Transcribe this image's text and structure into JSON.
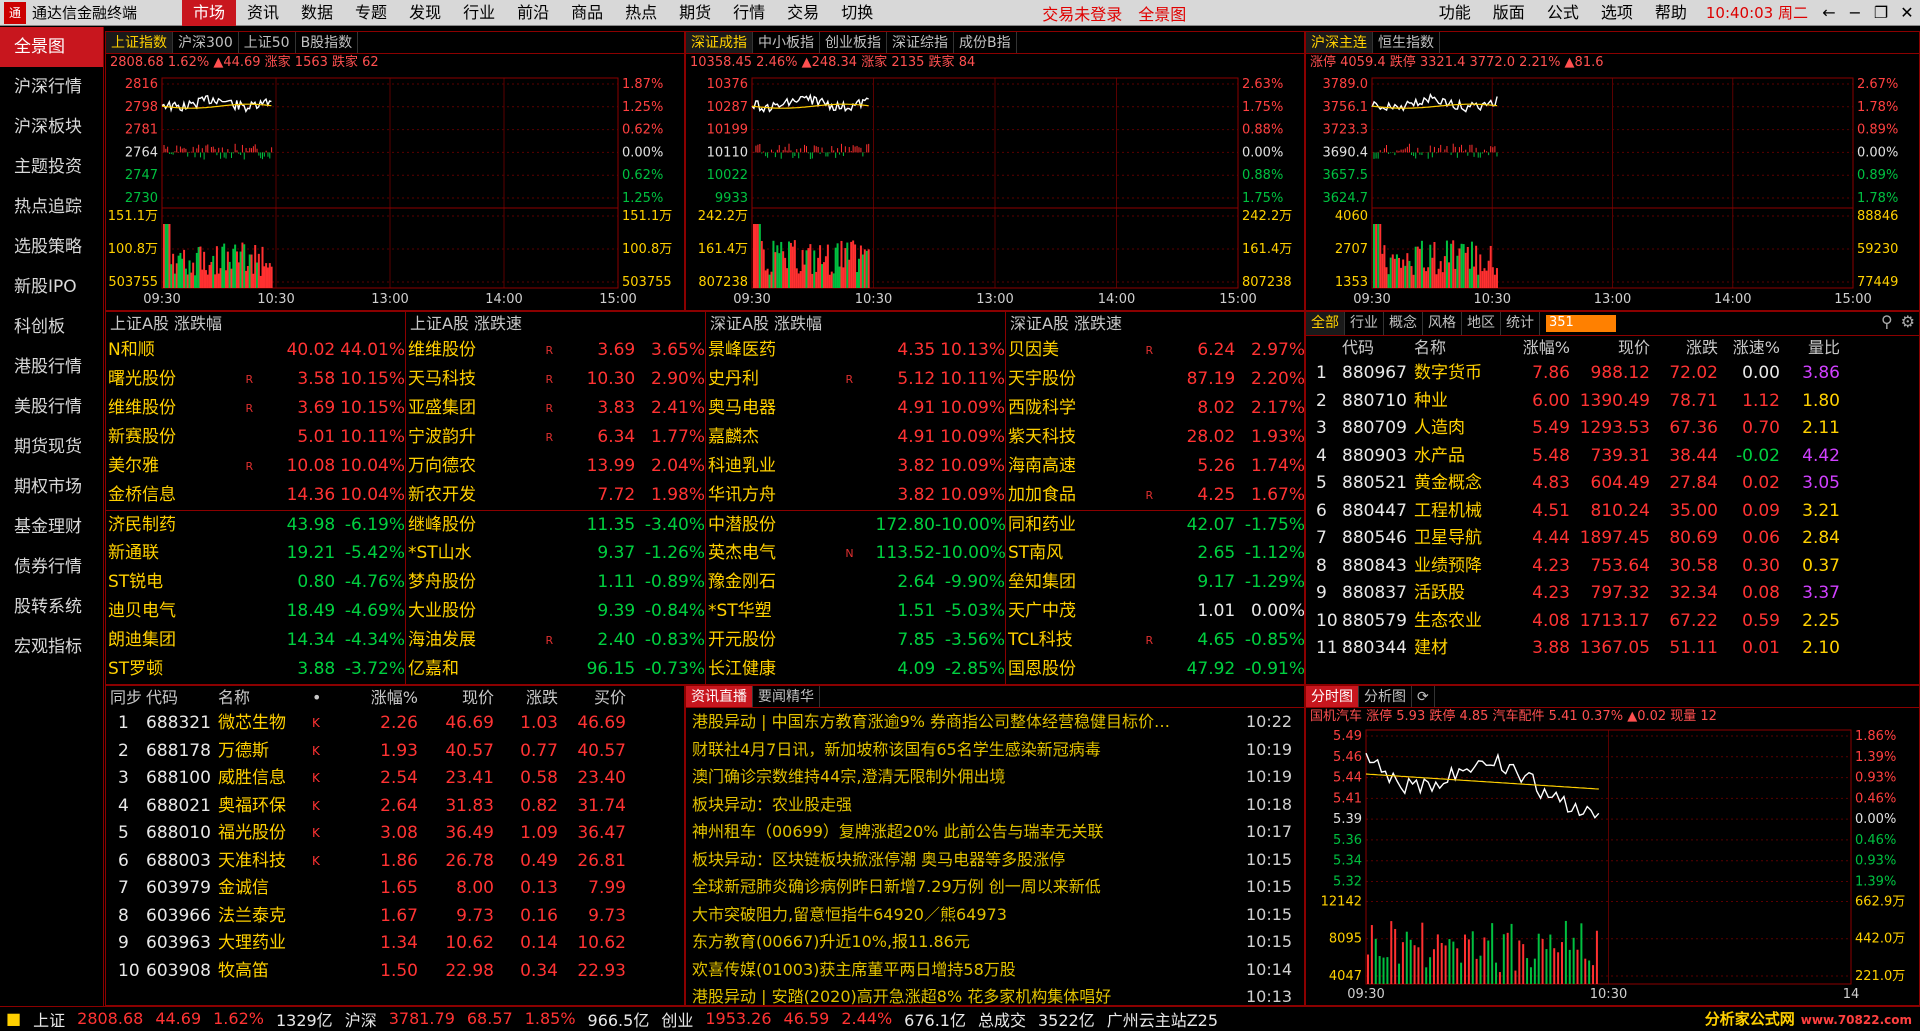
{
  "app": {
    "title": "通达信金融终端"
  },
  "menu": [
    "市场",
    "资讯",
    "数据",
    "专题",
    "发现",
    "行业",
    "前沿",
    "商品",
    "热点",
    "期货",
    "行情",
    "交易",
    "切换"
  ],
  "menu_alerts": [
    "交易未登录",
    "全景图"
  ],
  "right_menu": [
    "功能",
    "版面",
    "公式",
    "选项",
    "帮助"
  ],
  "clock": "10:40:03 周二",
  "sidebar": [
    "全景图",
    "沪深行情",
    "沪深板块",
    "主题投资",
    "热点追踪",
    "选股策略",
    "新股IPO",
    "科创板",
    "港股行情",
    "美股行情",
    "期货现货",
    "期权市场",
    "基金理财",
    "债券行情",
    "股转系统",
    "宏观指标"
  ],
  "charts": [
    {
      "tabs": [
        "上证指数",
        "沪深300",
        "上证50",
        "B股指数"
      ],
      "info": "2808.68 1.62% ▲44.69 涨家 1563 跌家 62",
      "price_labels": [
        "2816",
        "2798",
        "2781",
        "2764",
        "2747",
        "2730"
      ],
      "pct_labels": [
        "1.87%",
        "1.25%",
        "0.62%",
        "0.00%",
        "0.62%",
        "1.25%"
      ],
      "vol_labels": [
        "151.1万",
        "100.8万",
        "503755"
      ],
      "vol_labels_r": [
        "151.1万",
        "100.8万",
        "503755"
      ],
      "times": [
        "09:30",
        "10:30",
        "13:00",
        "14:00",
        "15:00"
      ]
    },
    {
      "tabs": [
        "深证成指",
        "中小板指",
        "创业板指",
        "深证综指",
        "成份B指"
      ],
      "info": "10358.45 2.46% ▲248.34 涨家 2135 跌家 84",
      "price_labels": [
        "10376",
        "10287",
        "10199",
        "10110",
        "10022",
        "9933"
      ],
      "pct_labels": [
        "2.63%",
        "1.75%",
        "0.88%",
        "0.00%",
        "0.88%",
        "1.75%"
      ],
      "vol_labels": [
        "242.2万",
        "161.4万",
        "807238"
      ],
      "vol_labels_r": [
        "242.2万",
        "161.4万",
        "807238"
      ],
      "times": [
        "09:30",
        "10:30",
        "13:00",
        "14:00",
        "15:00"
      ]
    },
    {
      "tabs": [
        "沪深主连",
        "恒生指数"
      ],
      "info": "涨停 4059.4 跌停 3321.4 3772.0 2.21% ▲81.6",
      "price_labels": [
        "3789.0",
        "3756.1",
        "3723.3",
        "3690.4",
        "3657.5",
        "3624.7"
      ],
      "pct_labels": [
        "2.67%",
        "1.78%",
        "0.89%",
        "0.00%",
        "0.89%",
        "1.78%"
      ],
      "vol_labels": [
        "4060",
        "2707",
        "1353"
      ],
      "vol_labels_r": [
        "88846",
        "59230",
        "77449"
      ],
      "times": [
        "09:30",
        "10:30",
        "13:00",
        "14:00",
        "15:00"
      ]
    }
  ],
  "rankings": [
    {
      "title": "上证A股  涨跌幅",
      "rows": [
        [
          "N和顺",
          "",
          "40.02",
          "44.01%"
        ],
        [
          "曙光股份",
          "R",
          "3.58",
          "10.15%"
        ],
        [
          "维维股份",
          "R",
          "3.69",
          "10.15%"
        ],
        [
          "新赛股份",
          "",
          "5.01",
          "10.11%"
        ],
        [
          "美尔雅",
          "R",
          "10.08",
          "10.04%"
        ],
        [
          "金桥信息",
          "",
          "14.36",
          "10.04%"
        ],
        [
          "济民制药",
          "",
          "43.98",
          "-6.19%"
        ],
        [
          "新通联",
          "",
          "19.21",
          "-5.42%"
        ],
        [
          "ST锐电",
          "",
          "0.80",
          "-4.76%"
        ],
        [
          "迪贝电气",
          "",
          "18.49",
          "-4.69%"
        ],
        [
          "朗迪集团",
          "",
          "14.34",
          "-4.34%"
        ],
        [
          "ST罗顿",
          "",
          "3.88",
          "-3.72%"
        ]
      ]
    },
    {
      "title": "上证A股  涨跌速",
      "rows": [
        [
          "维维股份",
          "R",
          "3.69",
          "3.65%"
        ],
        [
          "天马科技",
          "R",
          "10.30",
          "2.90%"
        ],
        [
          "亚盛集团",
          "R",
          "3.83",
          "2.41%"
        ],
        [
          "宁波韵升",
          "R",
          "6.34",
          "1.77%"
        ],
        [
          "万向德农",
          "",
          "13.99",
          "2.04%"
        ],
        [
          "新农开发",
          "",
          "7.72",
          "1.98%"
        ],
        [
          "继峰股份",
          "",
          "11.35",
          "-3.40%"
        ],
        [
          "*ST山水",
          "",
          "9.37",
          "-1.26%"
        ],
        [
          "梦舟股份",
          "",
          "1.11",
          "-0.89%"
        ],
        [
          "大业股份",
          "",
          "9.39",
          "-0.84%"
        ],
        [
          "海油发展",
          "R",
          "2.40",
          "-0.83%"
        ],
        [
          "亿嘉和",
          "",
          "96.15",
          "-0.73%"
        ]
      ]
    },
    {
      "title": "深证A股  涨跌幅",
      "rows": [
        [
          "景峰医药",
          "",
          "4.35",
          "10.13%"
        ],
        [
          "史丹利",
          "R",
          "5.12",
          "10.11%"
        ],
        [
          "奥马电器",
          "",
          "4.91",
          "10.09%"
        ],
        [
          "嘉麟杰",
          "",
          "4.91",
          "10.09%"
        ],
        [
          "科迪乳业",
          "",
          "3.82",
          "10.09%"
        ],
        [
          "华讯方舟",
          "",
          "3.82",
          "10.09%"
        ],
        [
          "中潜股份",
          "",
          "172.80",
          "-10.00%"
        ],
        [
          "英杰电气",
          "N",
          "113.52",
          "-10.00%"
        ],
        [
          "豫金刚石",
          "",
          "2.64",
          "-9.90%"
        ],
        [
          "*ST华塑",
          "",
          "1.51",
          "-5.03%"
        ],
        [
          "开元股份",
          "",
          "7.85",
          "-3.56%"
        ],
        [
          "长江健康",
          "",
          "4.09",
          "-2.85%"
        ]
      ]
    },
    {
      "title": "深证A股  涨跌速",
      "rows": [
        [
          "贝因美",
          "R",
          "6.24",
          "2.97%"
        ],
        [
          "天宇股份",
          "",
          "87.19",
          "2.20%"
        ],
        [
          "西陇科学",
          "",
          "8.02",
          "2.17%"
        ],
        [
          "紫天科技",
          "",
          "28.02",
          "1.93%"
        ],
        [
          "海南高速",
          "",
          "5.26",
          "1.74%"
        ],
        [
          "加加食品",
          "R",
          "4.25",
          "1.67%"
        ],
        [
          "同和药业",
          "",
          "42.07",
          "-1.75%"
        ],
        [
          "ST南风",
          "",
          "2.65",
          "-1.12%"
        ],
        [
          "垒知集团",
          "",
          "9.17",
          "-1.29%"
        ],
        [
          "天广中茂",
          "",
          "1.01",
          "0.00%"
        ],
        [
          "TCL科技",
          "R",
          "4.65",
          "-0.85%"
        ],
        [
          "国恩股份",
          "",
          "47.92",
          "-0.91%"
        ]
      ]
    }
  ],
  "sector": {
    "tabs": [
      "全部",
      "行业",
      "概念",
      "风格",
      "地区",
      "统计"
    ],
    "search": "351",
    "headers": [
      "",
      "代码",
      "名称",
      "涨幅%",
      "现价",
      "涨跌",
      "涨速%",
      "量比"
    ],
    "rows": [
      [
        "1",
        "880967",
        "数字货币",
        "7.86",
        "988.12",
        "72.02",
        "0.00",
        "3.86"
      ],
      [
        "2",
        "880710",
        "种业",
        "6.00",
        "1390.49",
        "78.71",
        "1.12",
        "1.80"
      ],
      [
        "3",
        "880709",
        "人造肉",
        "5.49",
        "1293.53",
        "67.36",
        "0.70",
        "2.11"
      ],
      [
        "4",
        "880903",
        "水产品",
        "5.48",
        "739.31",
        "38.44",
        "-0.02",
        "4.42"
      ],
      [
        "5",
        "880521",
        "黄金概念",
        "4.83",
        "604.49",
        "27.84",
        "0.02",
        "3.05"
      ],
      [
        "6",
        "880447",
        "工程机械",
        "4.51",
        "810.24",
        "35.00",
        "0.09",
        "3.21"
      ],
      [
        "7",
        "880546",
        "卫星导航",
        "4.44",
        "1897.45",
        "80.69",
        "0.06",
        "2.84"
      ],
      [
        "8",
        "880843",
        "业绩预降",
        "4.23",
        "753.64",
        "30.58",
        "0.30",
        "0.37"
      ],
      [
        "9",
        "880837",
        "活跃股",
        "4.23",
        "797.32",
        "32.34",
        "0.08",
        "3.37"
      ],
      [
        "10",
        "880579",
        "生态农业",
        "4.08",
        "1713.17",
        "67.22",
        "0.59",
        "2.25"
      ],
      [
        "11",
        "880344",
        "建材",
        "3.88",
        "1367.05",
        "51.11",
        "0.01",
        "2.10"
      ]
    ]
  },
  "stocks": {
    "headers": [
      "同步",
      "代码",
      "名称",
      "•",
      "涨幅%",
      "现价",
      "涨跌",
      "买价"
    ],
    "rows": [
      [
        "1",
        "688321",
        "微芯生物",
        "K",
        "2.26",
        "46.69",
        "1.03",
        "46.69"
      ],
      [
        "2",
        "688178",
        "万德斯",
        "K",
        "1.93",
        "40.57",
        "0.77",
        "40.57"
      ],
      [
        "3",
        "688100",
        "威胜信息",
        "K",
        "2.54",
        "23.41",
        "0.58",
        "23.40"
      ],
      [
        "4",
        "688021",
        "奥福环保",
        "K",
        "2.64",
        "31.83",
        "0.82",
        "31.74"
      ],
      [
        "5",
        "688010",
        "福光股份",
        "K",
        "3.08",
        "36.49",
        "1.09",
        "36.47"
      ],
      [
        "6",
        "688003",
        "天准科技",
        "K",
        "1.86",
        "26.78",
        "0.49",
        "26.81"
      ],
      [
        "7",
        "603979",
        "金诚信",
        "",
        "1.65",
        "8.00",
        "0.13",
        "7.99"
      ],
      [
        "8",
        "603966",
        "法兰泰克",
        "",
        "1.67",
        "9.73",
        "0.16",
        "9.73"
      ],
      [
        "9",
        "603963",
        "大理药业",
        "",
        "1.34",
        "10.62",
        "0.14",
        "10.62"
      ],
      [
        "10",
        "603908",
        "牧高笛",
        "",
        "1.50",
        "22.98",
        "0.34",
        "22.93"
      ]
    ]
  },
  "news": {
    "tabs": [
      "资讯直播",
      "要闻精华"
    ],
    "rows": [
      [
        "港股异动 | 中国东方教育涨逾9% 券商指公司整体经营稳健目标价…",
        "10:22"
      ],
      [
        "财联社4月7日讯，新加坡称该国有65名学生感染新冠病毒",
        "10:19"
      ],
      [
        "澳门确诊宗数维持44宗,澄清无限制外佣出境",
        "10:19"
      ],
      [
        "板块异动：农业股走强",
        "10:18"
      ],
      [
        "神州租车（00699）复牌涨超20% 此前公告与瑞幸无关联",
        "10:17"
      ],
      [
        "板块异动：区块链板块掀涨停潮 奥马电器等多股涨停",
        "10:15"
      ],
      [
        "全球新冠肺炎确诊病例昨日新增7.29万例 创一周以来新低",
        "10:15"
      ],
      [
        "大市突破阻力,留意恒指牛64920／熊64973",
        "10:15"
      ],
      [
        "东方教育(00667)升近10%,报11.86元",
        "10:15"
      ],
      [
        "欢喜传媒(01003)获主席董平两日增持58万股",
        "10:14"
      ],
      [
        "港股异动 | 安踏(2020)高开急涨超8% 花多家机构集体唱好",
        "10:13"
      ]
    ]
  },
  "mini": {
    "tabs": [
      "分时图",
      "分析图"
    ],
    "info": "国机汽车 涨停 5.93 跌停 4.85 汽车配件 5.41 0.37% ▲0.02 现量 12",
    "price_labels": [
      "5.49",
      "5.46",
      "5.44",
      "5.41",
      "5.39",
      "5.36",
      "5.34",
      "5.32"
    ],
    "pct_labels": [
      "1.86%",
      "1.39%",
      "0.93%",
      "0.46%",
      "0.00%",
      "0.46%",
      "0.93%",
      "1.39%"
    ],
    "vol_labels": [
      "12142",
      "8095",
      "4047"
    ],
    "vol_labels_r": [
      "662.9万",
      "442.0万",
      "221.0万"
    ],
    "times": [
      "09:30",
      "10:30",
      "14"
    ]
  },
  "status": {
    "items": [
      [
        "上证",
        "2808.68",
        "44.69",
        "1.62%",
        "1329亿"
      ],
      [
        "沪深",
        "3781.79",
        "68.57",
        "1.85%",
        "966.5亿"
      ],
      [
        "创业",
        "1953.26",
        "46.59",
        "2.44%",
        "676.1亿"
      ]
    ],
    "total_label": "总成交",
    "total": "3522亿",
    "site": "广州云主站Z25",
    "watermark": "分析家公式网",
    "watermark_url": "www.70822.com"
  }
}
